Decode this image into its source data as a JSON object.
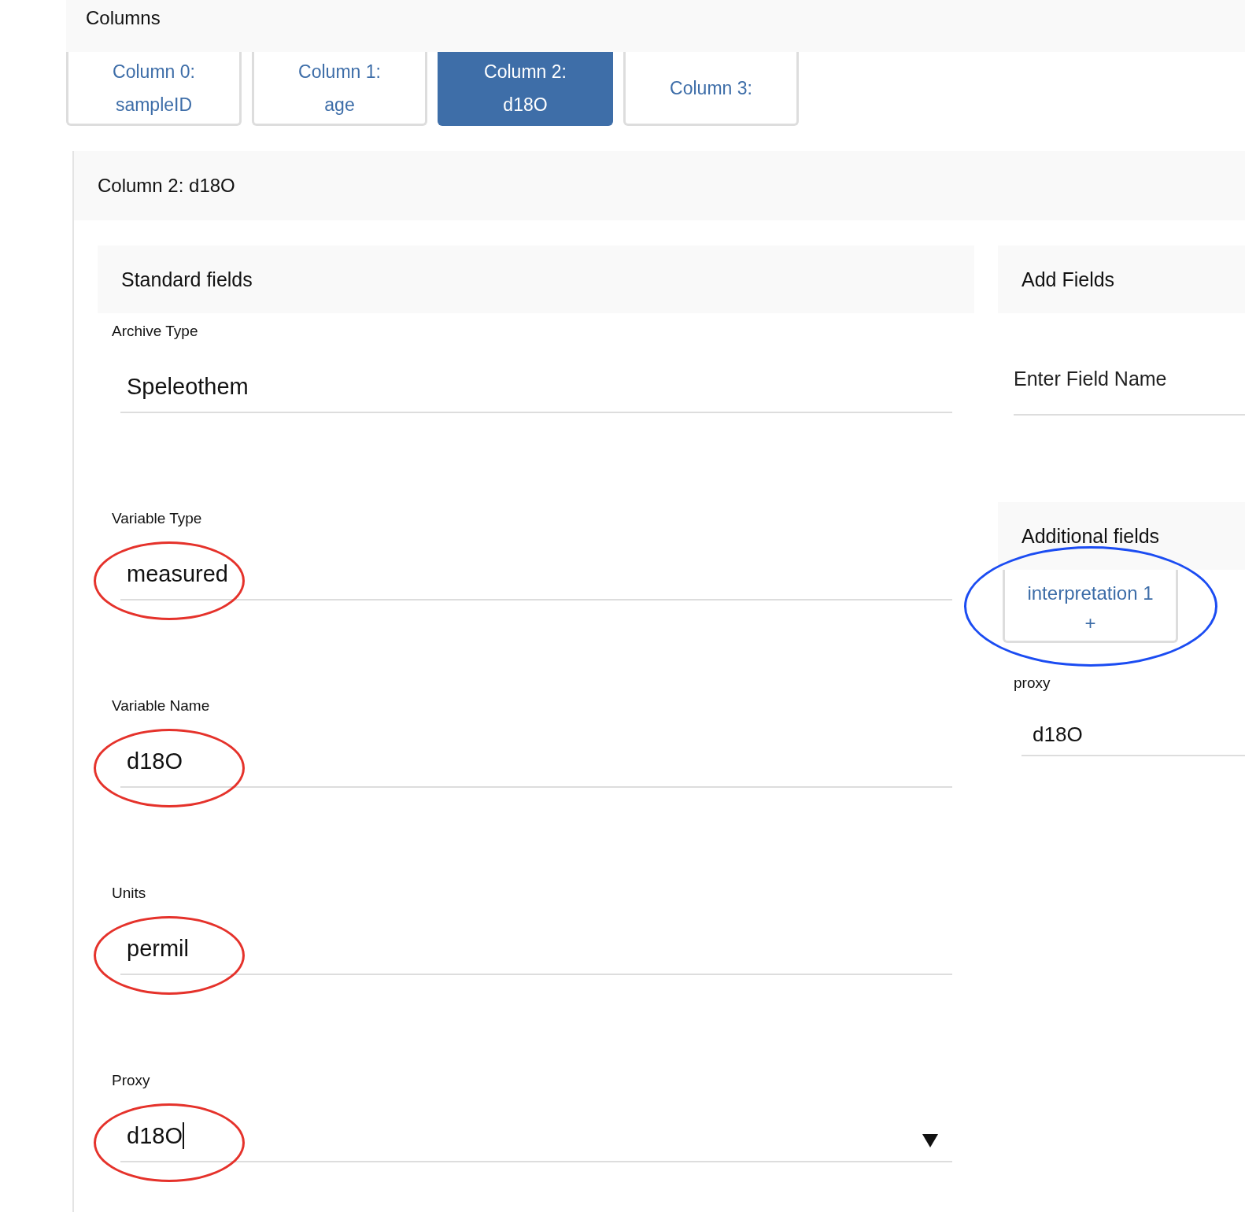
{
  "section_title": "Columns",
  "tabs": [
    {
      "label": "Column 0:",
      "sublabel": "sampleID",
      "selected": false
    },
    {
      "label": "Column 1:",
      "sublabel": "age",
      "selected": false
    },
    {
      "label": "Column 2:",
      "sublabel": "d18O",
      "selected": true
    },
    {
      "label": "Column 3:",
      "selected": false
    }
  ],
  "panel": {
    "title": "Column 2: d18O",
    "standard_fields": {
      "title": "Standard fields",
      "fields": [
        {
          "kind": "text",
          "label": "Archive Type",
          "value": "Speleothem"
        },
        {
          "kind": "text",
          "label": "Variable Type",
          "value": "measured",
          "annotation": {
            "color": "#e5322b"
          }
        },
        {
          "kind": "text",
          "label": "Variable Name",
          "value": "d18O",
          "annotation": {
            "color": "#e5322b"
          }
        },
        {
          "kind": "text",
          "label": "Units",
          "value": "permil",
          "annotation": {
            "color": "#e5322b"
          }
        },
        {
          "kind": "select",
          "label": "Proxy",
          "value": "d18O",
          "focused": true,
          "annotation": {
            "color": "#e5322b"
          }
        }
      ]
    },
    "add_fields": {
      "title": "Add Fields",
      "placeholder": "Enter Field Name"
    },
    "additional_fields": {
      "title": "Additional fields",
      "button": {
        "label": "interpretation 1",
        "icon": "+",
        "annotation": {
          "color": "#1b4cf2"
        }
      },
      "fields": [
        {
          "label": "proxy",
          "value": "d18O"
        }
      ]
    }
  }
}
